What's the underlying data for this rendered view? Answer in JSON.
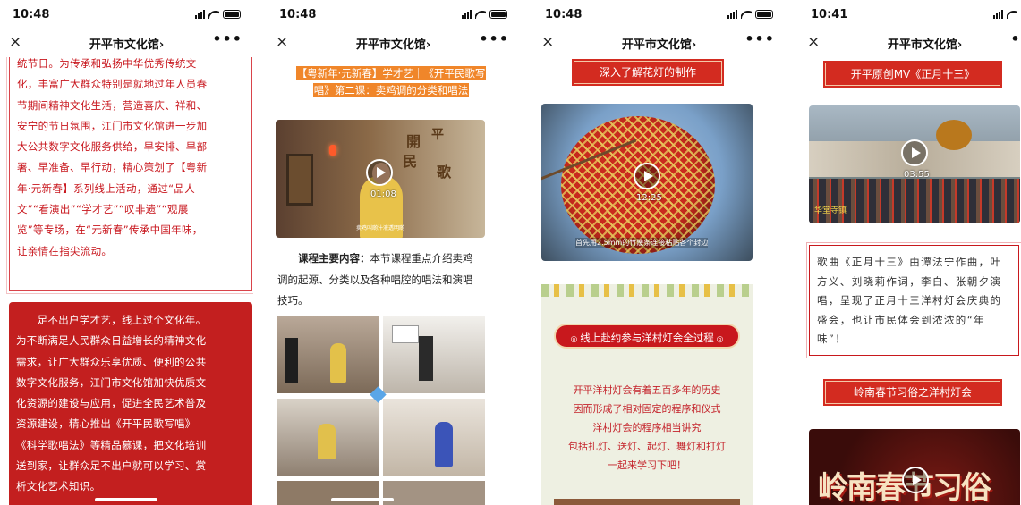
{
  "nav": {
    "title": "开平市文化馆",
    "chevron": "›",
    "more": "•••",
    "close": "×"
  },
  "panels": [
    {
      "time": "10:48",
      "box_lines": [
        "统节日。为传承和弘扬中华优秀传统文",
        "化，丰富广大群众特别是就地过年人员春",
        "节期间精神文化生活，营造喜庆、祥和、",
        "安宁的节日氛围，江门市文化馆进一步加",
        "大公共数字文化服务供给，早安排、早部",
        "署、早准备、早行动，精心策划了【粤新",
        "年·元新春】系列线上活动，通过“品人",
        "文”“看演出”“学才艺”“叹非遗”“观展",
        "览”等专场，在“元新春”传承中国年味，",
        "让亲情在指尖流动。"
      ],
      "red_lines": [
        "　　足不出户学才艺，线上过个文化年。",
        "为不断满足人民群众日益增长的精神文化",
        "需求，让广大群众乐享优质、便利的公共",
        "数字文化服务，江门市文化馆加快优质文",
        "化资源的建设与应用，促进全民艺术普及",
        "资源建设，精心推出《开平民歌写唱》",
        "《科学歌唱法》等精品慕课，把文化培训",
        "送到家，让群众足不出户就可以学习、赏",
        "析文化艺术知识。"
      ]
    },
    {
      "time": "10:48",
      "headline_lines": [
        "【粤新年·元新春】学才艺｜《开平民歌写",
        "唱》第二课：卖鸡调的分类和唱法"
      ],
      "video": {
        "duration": "01:08",
        "art_text": [
          "開",
          "平",
          "民",
          "歌"
        ],
        "caption": "卖鸡叫啲汁液透明啲"
      },
      "desc_label": "课程主要内容：",
      "desc_lines": [
        "本节课程重点介绍卖鸡",
        "调的起源、分类以及各种唱腔的唱法和演唱",
        "技巧。"
      ]
    },
    {
      "time": "10:48",
      "banner1": "深入了解花灯的制作",
      "video": {
        "duration": "12:25",
        "caption": "首先用2.5mm的竹篾条连接粘贴各个封边"
      },
      "banner2": "线上赴约参与洋村灯会全过程",
      "card_lines": [
        "开平洋村灯会有着五百多年的历史",
        "因而形成了相对固定的程序和仪式",
        "洋村灯会的程序相当讲究",
        "包括扎灯、送灯、起灯、舞灯和打灯",
        "一起来学习下吧！"
      ]
    },
    {
      "time": "10:41",
      "banner1": "开平原创MV《正月十三》",
      "video": {
        "duration": "03:55",
        "caption": "华堂寺镇"
      },
      "box_lines": [
        "歌曲《正月十三》由谭法宁作曲，叶",
        "方义、刘晓莉作词，李白、张朝夕演",
        "唱，呈现了正月十三洋村灯会庆典的",
        "盛会，也让市民体会到浓浓的“年",
        "味”！"
      ],
      "banner2": "岭南春节习俗之洋村灯会",
      "big_text": "岭南春节习俗"
    }
  ]
}
